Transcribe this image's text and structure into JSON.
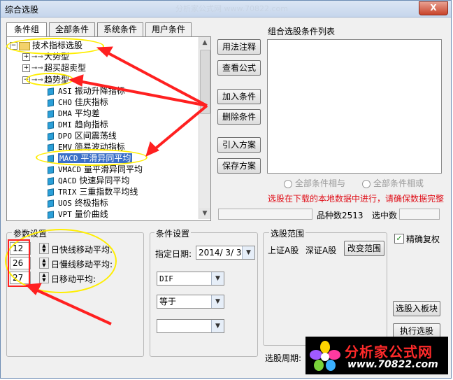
{
  "window": {
    "title": "综合选股",
    "title_watermark": "分析家公式网 www.70822.com",
    "close_label": "X"
  },
  "tabs": [
    {
      "label": "条件组",
      "active": true
    },
    {
      "label": "全部条件",
      "active": false
    },
    {
      "label": "系统条件",
      "active": false
    },
    {
      "label": "用户条件",
      "active": false
    }
  ],
  "tree": {
    "root": {
      "expander": "−",
      "label": "技术指标选股"
    },
    "groups": [
      {
        "expander": "+",
        "label": "大势型"
      },
      {
        "expander": "+",
        "label": "超买超卖型"
      },
      {
        "expander": "−",
        "label": "趋势型"
      }
    ],
    "items": [
      {
        "code": "ASI",
        "name": "振动升降指标"
      },
      {
        "code": "CHO",
        "name": "佳庆指标"
      },
      {
        "code": "DMA",
        "name": "平均差"
      },
      {
        "code": "DMI",
        "name": "趋向指标"
      },
      {
        "code": "DPO",
        "name": "区间震荡线"
      },
      {
        "code": "EMV",
        "name": "简易波动指标"
      },
      {
        "code": "MACD",
        "name": "平滑异同平均"
      },
      {
        "code": "VMACD",
        "name": "量平滑异同平均"
      },
      {
        "code": "QACD",
        "name": "快速异同平均"
      },
      {
        "code": "TRIX",
        "name": "三重指数平均线"
      },
      {
        "code": "UOS",
        "name": "终极指标"
      },
      {
        "code": "VPT",
        "name": "量价曲线"
      }
    ],
    "selected_code": "MACD"
  },
  "buttons": {
    "usage": "用法注释",
    "view_formula": "查看公式",
    "add_condition": "加入条件",
    "delete_condition": "删除条件",
    "import_plan": "引入方案",
    "save_plan": "保存方案",
    "change_range": "改变范围",
    "select_to_block": "选股入板块",
    "execute": "执行选股"
  },
  "condition_list": {
    "title": "组合选股条件列表",
    "radio_and": "全部条件相与",
    "radio_or": "全部条件相或"
  },
  "warning": "选股在下载的本地数据中进行，请确保数据完整",
  "stats": {
    "variety_label": "品种数",
    "variety_count": "2513",
    "selected_label": "选中数"
  },
  "params": {
    "legend": "参数设置",
    "rows": [
      {
        "value": "12",
        "label": "日快线移动平均:"
      },
      {
        "value": "26",
        "label": "日慢线移动平均:"
      },
      {
        "value": "27",
        "label": "日移动平均:"
      }
    ]
  },
  "condition": {
    "legend": "条件设置",
    "date_label": "指定日期:",
    "date_value": "2014/ 3/ 3",
    "line_value": "DIF",
    "op_value": "等于",
    "value_value": ""
  },
  "range": {
    "legend": "选股范围",
    "text_a": "上证A股",
    "text_b": "深证A股"
  },
  "exact_reweight": {
    "label": "精确复权",
    "checked": true
  },
  "period": {
    "label": "选股周期:"
  },
  "logo": {
    "brand": "分析家公式网",
    "url": "www.70822.com"
  },
  "colors": {
    "annotation_red": "#ff2020",
    "annotation_yellow": "#ffee00",
    "warning_red": "#e0101a"
  }
}
